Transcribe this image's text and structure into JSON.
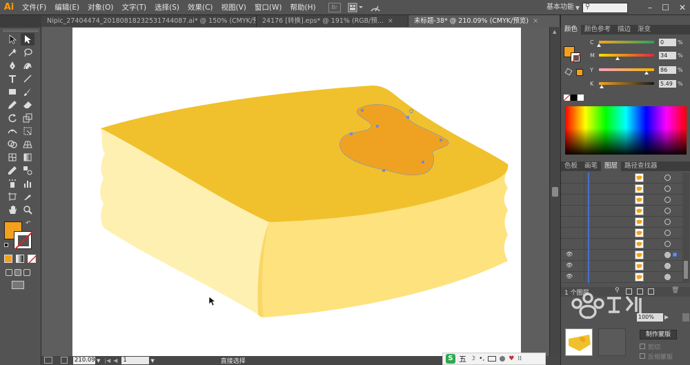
{
  "app": {
    "logo": "Ai"
  },
  "menu": [
    "文件(F)",
    "编辑(E)",
    "对象(O)",
    "文字(T)",
    "选择(S)",
    "效果(C)",
    "视图(V)",
    "窗口(W)",
    "帮助(H)"
  ],
  "menu_icons": {
    "bridge": "Br"
  },
  "workspace": {
    "label": "基本功能",
    "search_icon": "search-icon"
  },
  "window_controls": [
    "–",
    "☐",
    "✕"
  ],
  "tabs": [
    {
      "label": "Nipic_27404474_20180818232531744087.ai* @ 150% (CMYK/预...",
      "close": "×"
    },
    {
      "label": "24176 [转换].eps* @ 191% (RGB/预...",
      "close": "×"
    },
    {
      "label": "未标题-38* @ 210.09% (CMYK/预览)",
      "close": "×",
      "active": true
    }
  ],
  "status": {
    "zoom": "210.09",
    "page": "1",
    "tool": "直接选择"
  },
  "color_panel": {
    "tabs": [
      "颜色",
      "颜色参考",
      "描边",
      "渐变"
    ],
    "channels": [
      {
        "label": "C",
        "value": "0",
        "pct": "%",
        "pos": 0.0,
        "gradient": "linear-gradient(to right,#f5a623,#2aa35a)"
      },
      {
        "label": "M",
        "value": "34",
        "pct": "%",
        "pos": 0.34,
        "gradient": "linear-gradient(to right,#f7e000,#e8243c)"
      },
      {
        "label": "Y",
        "value": "86",
        "pct": "%",
        "pos": 0.86,
        "gradient": "linear-gradient(to right,#f4a3c0,#f4b400)"
      },
      {
        "label": "K",
        "value": "5.49",
        "pct": "%",
        "pos": 0.055,
        "gradient": "linear-gradient(to right,#f5a623,#1a1a1a)"
      }
    ],
    "fill_color": "#f4a01c"
  },
  "layers_panel": {
    "tabs": [
      "色板",
      "画笔",
      "图层",
      "路径查找器"
    ],
    "footer": "1 个图层",
    "rows": [
      {
        "visible": false,
        "target": "ring"
      },
      {
        "visible": false,
        "target": "ring"
      },
      {
        "visible": false,
        "target": "ring"
      },
      {
        "visible": false,
        "target": "ring"
      },
      {
        "visible": false,
        "target": "ring"
      },
      {
        "visible": false,
        "target": "ring"
      },
      {
        "visible": false,
        "target": "ring"
      },
      {
        "visible": true,
        "target": "selected"
      },
      {
        "visible": true,
        "target": "filled"
      },
      {
        "visible": true,
        "target": "filled"
      }
    ]
  },
  "transparency": {
    "percent": "100%",
    "btn_label": "制作蒙版",
    "clip": "剪切",
    "invert": "反相蒙版"
  },
  "taskbar": {
    "ime": "五"
  }
}
